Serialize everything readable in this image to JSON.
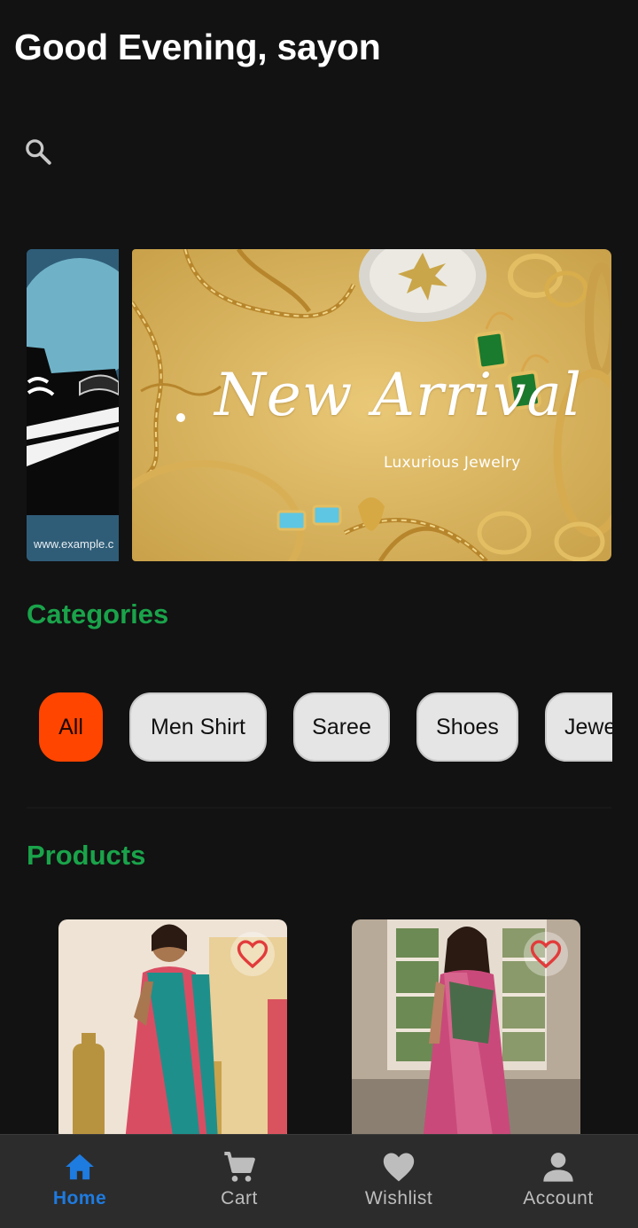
{
  "header": {
    "greeting": "Good Evening, sayon",
    "search_icon": "search-icon"
  },
  "banners": {
    "previous": {
      "url_text": "www.example.c"
    },
    "current": {
      "title": "New Arrival",
      "subtitle": "Luxurious Jewelry"
    }
  },
  "categories": {
    "title": "Categories",
    "items": [
      {
        "label": "All",
        "active": true
      },
      {
        "label": "Men Shirt",
        "active": false
      },
      {
        "label": "Saree",
        "active": false
      },
      {
        "label": "Shoes",
        "active": false
      },
      {
        "label": "Jewe",
        "active": false
      }
    ]
  },
  "products": {
    "title": "Products",
    "items": [
      {
        "name": "saree-product-1",
        "favorite_icon": "heart-outline-icon"
      },
      {
        "name": "saree-product-2",
        "favorite_icon": "heart-outline-icon"
      }
    ]
  },
  "bottom_nav": {
    "items": [
      {
        "label": "Home",
        "icon": "home-icon",
        "active": true
      },
      {
        "label": "Cart",
        "icon": "cart-icon",
        "active": false
      },
      {
        "label": "Wishlist",
        "icon": "heart-icon",
        "active": false
      },
      {
        "label": "Account",
        "icon": "person-icon",
        "active": false
      }
    ]
  },
  "colors": {
    "background": "#121212",
    "section_title": "#1aa34a",
    "active_chip": "#ff4500",
    "nav_active": "#1e7be0",
    "nav_inactive": "#bdbdbd",
    "nav_background": "#2c2c2c"
  }
}
